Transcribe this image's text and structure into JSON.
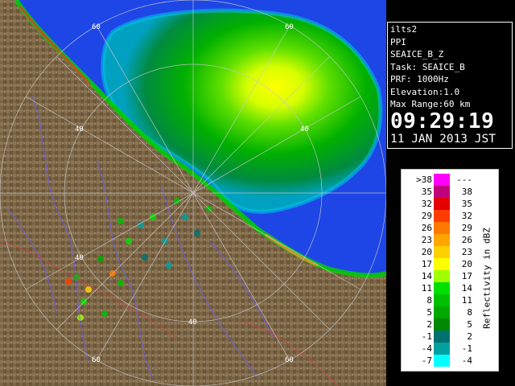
{
  "info": {
    "station": "ilts2",
    "scan_type": "PPI",
    "product": "SEAICE_B_Z",
    "task": "Task: SEAICE_B",
    "prf": "PRF: 1000Hz",
    "elevation": "Elevation:1.0",
    "max_range": "Max Range:60 km",
    "time": "09:29:19",
    "date": "11 JAN 2013 JST"
  },
  "range_labels": [
    "40",
    "60"
  ],
  "legend": {
    "unit_label": "Reflectivity in dBZ",
    "rows": [
      {
        "lo": ">38",
        "hi": "---",
        "color": "#ff00ff"
      },
      {
        "lo": "35",
        "hi": "38",
        "color": "#c0007a"
      },
      {
        "lo": "32",
        "hi": "35",
        "color": "#e40000"
      },
      {
        "lo": "29",
        "hi": "32",
        "color": "#ff3c00"
      },
      {
        "lo": "26",
        "hi": "29",
        "color": "#ff7800"
      },
      {
        "lo": "23",
        "hi": "26",
        "color": "#ffa500"
      },
      {
        "lo": "20",
        "hi": "23",
        "color": "#ffd000"
      },
      {
        "lo": "17",
        "hi": "20",
        "color": "#ffff00"
      },
      {
        "lo": "14",
        "hi": "17",
        "color": "#a0ff00"
      },
      {
        "lo": "11",
        "hi": "14",
        "color": "#00e000"
      },
      {
        "lo": "8",
        "hi": "11",
        "color": "#00c000"
      },
      {
        "lo": "5",
        "hi": "8",
        "color": "#00a800"
      },
      {
        "lo": "2",
        "hi": "5",
        "color": "#008800"
      },
      {
        "lo": "-1",
        "hi": "2",
        "color": "#007070"
      },
      {
        "lo": "-4",
        "hi": "-1",
        "color": "#00a0a0"
      },
      {
        "lo": "-7",
        "hi": "-4",
        "color": "#00ffff"
      }
    ]
  },
  "colors": {
    "sea": "#1e46e6",
    "land": "#7a6446",
    "land_light": "#9a8462",
    "river": "#6a5aff",
    "border": "#d44040",
    "ring": "#c8c8c8"
  }
}
